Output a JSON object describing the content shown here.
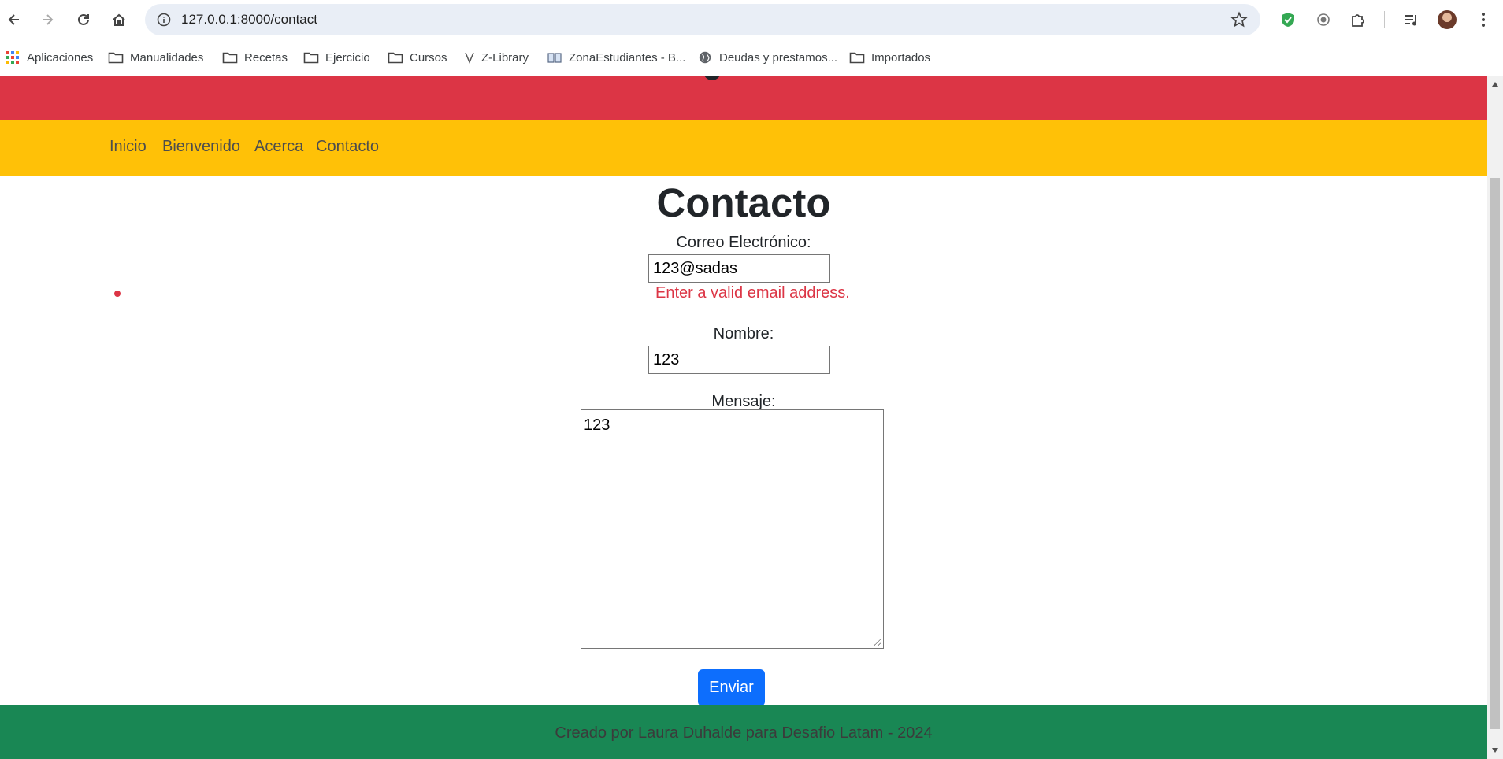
{
  "browser": {
    "url": "127.0.0.1:8000/contact",
    "bookmarks": [
      {
        "label": "Aplicaciones",
        "icon": "apps-grid-icon"
      },
      {
        "label": "Manualidades",
        "icon": "folder-icon"
      },
      {
        "label": "Recetas",
        "icon": "folder-icon"
      },
      {
        "label": "Ejercicio",
        "icon": "folder-icon"
      },
      {
        "label": "Cursos",
        "icon": "folder-icon"
      },
      {
        "label": "Z-Library",
        "icon": "zlibrary-icon"
      },
      {
        "label": "ZonaEstudiantes - B...",
        "icon": "book-icon"
      },
      {
        "label": "Deudas y prestamos...",
        "icon": "globe-icon"
      },
      {
        "label": "Importados",
        "icon": "folder-icon"
      }
    ]
  },
  "nav": {
    "items": [
      "Inicio",
      "Bienvenido",
      "Acerca",
      "Contacto"
    ]
  },
  "page": {
    "title": "Contacto",
    "form": {
      "email_label": "Correo Electrónico:",
      "email_value": "123@sadas",
      "email_error": "Enter a valid email address.",
      "name_label": "Nombre:",
      "name_value": "123",
      "message_label": "Mensaje:",
      "message_value": "123",
      "submit_label": "Enviar"
    },
    "footer": "Creado por Laura Duhalde para Desafio Latam - 2024"
  },
  "colors": {
    "red_band": "#dc3545",
    "nav_bg": "#ffc107",
    "footer_bg": "#198754",
    "button": "#0d6efd",
    "error": "#dc3545"
  }
}
